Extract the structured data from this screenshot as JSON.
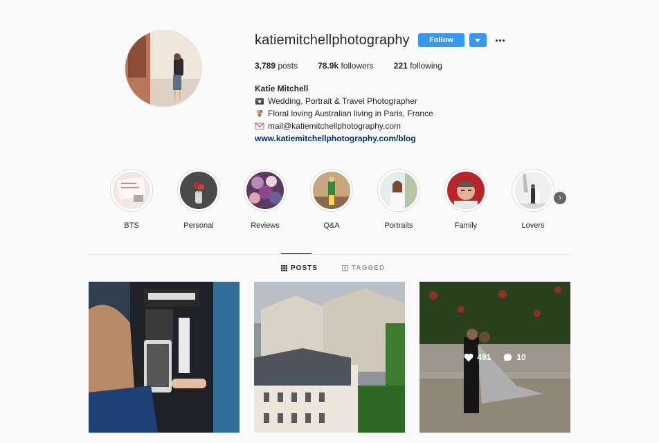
{
  "profile": {
    "username": "katiemitchellphotography",
    "follow_label": "Follow",
    "stats": [
      {
        "value": "3,789",
        "label": "posts"
      },
      {
        "value": "78.9k",
        "label": "followers"
      },
      {
        "value": "221",
        "label": "following"
      }
    ],
    "full_name": "Katie Mitchell",
    "bio_lines": [
      {
        "icon": "camera-icon",
        "text": "Wedding, Portrait & Travel Photographer"
      },
      {
        "icon": "bouquet-icon",
        "text": "Floral loving Australian living in Paris, France"
      },
      {
        "icon": "envelope-icon",
        "text": "mail@katiemitchellphotography.com"
      }
    ],
    "website": "www.katiemitchellphotography.com/blog"
  },
  "highlights": [
    {
      "label": "BTS"
    },
    {
      "label": "Personal"
    },
    {
      "label": "Reviews"
    },
    {
      "label": "Q&A"
    },
    {
      "label": "Portraits"
    },
    {
      "label": "Family"
    },
    {
      "label": "Lovers"
    }
  ],
  "tabs": [
    {
      "label": "POSTS",
      "icon": "grid-icon",
      "active": true
    },
    {
      "label": "TAGGED",
      "icon": "tagged-icon",
      "active": false
    }
  ],
  "posts_overlay": {
    "likes": "491",
    "comments": "10"
  },
  "colors": {
    "accent": "#3897f0",
    "link": "#003569",
    "text": "#262626",
    "muted": "#999999"
  }
}
